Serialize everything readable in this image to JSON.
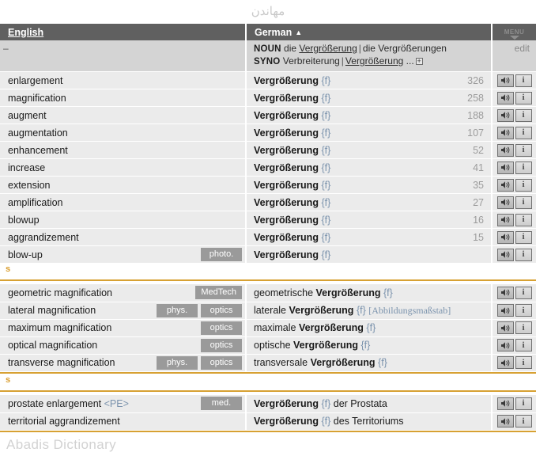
{
  "page": {
    "top_watermark": "مهاندن",
    "bottom_watermark": "Abadis Dictionary"
  },
  "header": {
    "english_label": "English",
    "german_label": "German",
    "sort_caret": "▲",
    "menu_label": "MENU"
  },
  "info_row": {
    "english_placeholder": "–",
    "noun_key": "NOUN",
    "noun_article": "die",
    "noun_singular": "Vergrößerung",
    "noun_separator": "|",
    "noun_plural_article": "die",
    "noun_plural": "Vergrößerungen",
    "syno_key": "SYNO",
    "syno_first": "Verbreiterung",
    "syno_separator": "|",
    "syno_second": "Vergrößerung",
    "syno_ellipsis": "...",
    "expand_icon": "+",
    "edit_label": "edit"
  },
  "icons": {
    "speaker": "speaker-icon",
    "info": "i"
  },
  "sections": [
    {
      "label": "",
      "has_divider": false,
      "rows": [
        {
          "english": "enlargement",
          "tags": [],
          "german_head": "Vergrößerung",
          "gender": "{f}",
          "german_rest": "",
          "german_bracket": "",
          "count": "326"
        },
        {
          "english": "magnification",
          "tags": [],
          "german_head": "Vergrößerung",
          "gender": "{f}",
          "german_rest": "",
          "german_bracket": "",
          "count": "258"
        },
        {
          "english": "augment",
          "tags": [],
          "german_head": "Vergrößerung",
          "gender": "{f}",
          "german_rest": "",
          "german_bracket": "",
          "count": "188"
        },
        {
          "english": "augmentation",
          "tags": [],
          "german_head": "Vergrößerung",
          "gender": "{f}",
          "german_rest": "",
          "german_bracket": "",
          "count": "107"
        },
        {
          "english": "enhancement",
          "tags": [],
          "german_head": "Vergrößerung",
          "gender": "{f}",
          "german_rest": "",
          "german_bracket": "",
          "count": "52"
        },
        {
          "english": "increase",
          "tags": [],
          "german_head": "Vergrößerung",
          "gender": "{f}",
          "german_rest": "",
          "german_bracket": "",
          "count": "41"
        },
        {
          "english": "extension",
          "tags": [],
          "german_head": "Vergrößerung",
          "gender": "{f}",
          "german_rest": "",
          "german_bracket": "",
          "count": "35"
        },
        {
          "english": "amplification",
          "tags": [],
          "german_head": "Vergrößerung",
          "gender": "{f}",
          "german_rest": "",
          "german_bracket": "",
          "count": "27"
        },
        {
          "english": "blowup",
          "tags": [],
          "german_head": "Vergrößerung",
          "gender": "{f}",
          "german_rest": "",
          "german_bracket": "",
          "count": "16"
        },
        {
          "english": "aggrandizement",
          "tags": [],
          "german_head": "Vergrößerung",
          "gender": "{f}",
          "german_rest": "",
          "german_bracket": "",
          "count": "15"
        },
        {
          "english": "blow-up",
          "tags": [
            "photo."
          ],
          "german_head": "Vergrößerung",
          "gender": "{f}",
          "german_rest": "",
          "german_bracket": "",
          "count": ""
        }
      ]
    },
    {
      "label": "s",
      "has_divider": true,
      "rows": [
        {
          "english": "geometric magnification",
          "tags": [
            "MedTech"
          ],
          "german_prefix": "geometrische ",
          "german_head": "Vergrößerung",
          "gender": "{f}",
          "german_rest": "",
          "german_bracket": "",
          "count": ""
        },
        {
          "english": "lateral magnification",
          "tags": [
            "phys.",
            "optics"
          ],
          "german_prefix": "laterale ",
          "german_head": "Vergrößerung",
          "gender": "{f}",
          "german_rest": "",
          "german_bracket": "[Abbildungsmaßstab]",
          "count": ""
        },
        {
          "english": "maximum magnification",
          "tags": [
            "optics"
          ],
          "german_prefix": "maximale ",
          "german_head": "Vergrößerung",
          "gender": "{f}",
          "german_rest": "",
          "german_bracket": "",
          "count": ""
        },
        {
          "english": "optical magnification",
          "tags": [
            "optics"
          ],
          "german_prefix": "optische ",
          "german_head": "Vergrößerung",
          "gender": "{f}",
          "german_rest": "",
          "german_bracket": "",
          "count": ""
        },
        {
          "english": "transverse magnification",
          "tags": [
            "phys.",
            "optics"
          ],
          "german_prefix": "transversale ",
          "german_head": "Vergrößerung",
          "gender": "{f}",
          "german_rest": "",
          "german_bracket": "",
          "count": ""
        }
      ]
    },
    {
      "label": "s",
      "has_divider": true,
      "rows": [
        {
          "english": "prostate enlargement",
          "abbr": "<PE>",
          "tags": [
            "med."
          ],
          "german_prefix": "",
          "german_head": "Vergrößerung",
          "gender": "{f}",
          "german_rest": " der Prostata",
          "german_bracket": "",
          "count": ""
        },
        {
          "english": "territorial aggrandizement",
          "abbr": "",
          "tags": [],
          "german_prefix": "",
          "german_head": "Vergrößerung",
          "gender": "{f}",
          "german_rest": " des Territoriums",
          "german_bracket": "",
          "count": ""
        }
      ]
    }
  ],
  "colors": {
    "header_bg": "#606060",
    "row_bg": "#ebebeb",
    "info_bg": "#d4d4d4",
    "accent_orange": "#d7a133",
    "tag_bg": "#9a9a9a",
    "gender_blue": "#7b93ad",
    "count_grey": "#9b9b9b"
  }
}
